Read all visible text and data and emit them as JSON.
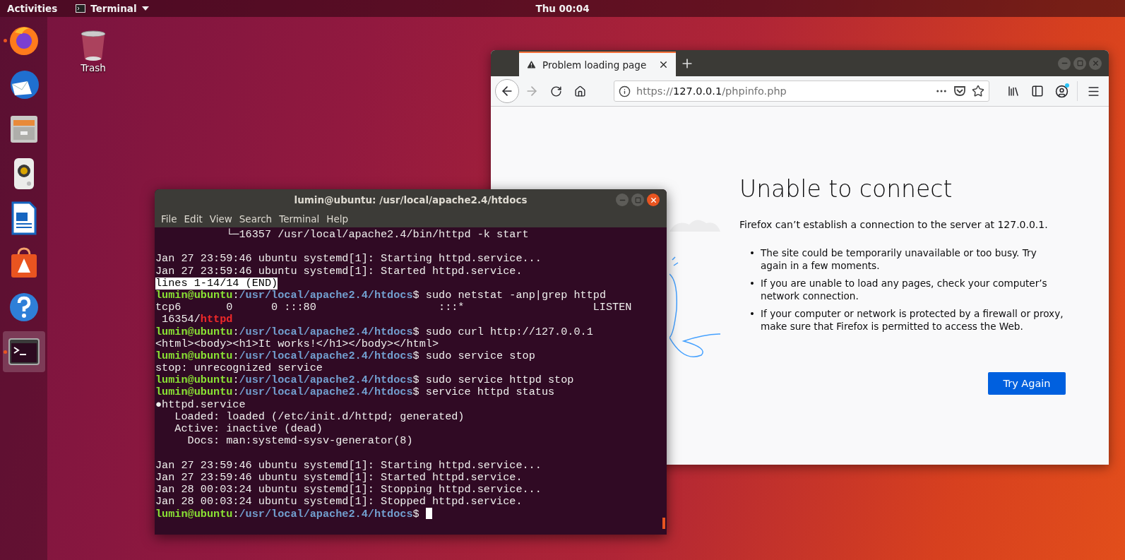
{
  "top_bar": {
    "activities": "Activities",
    "app_menu": "Terminal",
    "clock": "Thu 00:04"
  },
  "dock": {
    "items": [
      {
        "kind": "browser",
        "running": true,
        "selected": false
      },
      {
        "kind": "mail",
        "running": false,
        "selected": false
      },
      {
        "kind": "files",
        "running": false,
        "selected": false
      },
      {
        "kind": "music",
        "running": false,
        "selected": false
      },
      {
        "kind": "writer",
        "running": false,
        "selected": false
      },
      {
        "kind": "store",
        "running": false,
        "selected": false
      },
      {
        "kind": "help",
        "running": false,
        "selected": false
      },
      {
        "kind": "terminal",
        "running": true,
        "selected": true
      }
    ]
  },
  "desktop_icons": [
    {
      "kind": "trash",
      "label": "Trash"
    }
  ],
  "browser": {
    "tabs": [
      {
        "title": "Problem loading page",
        "selected": true
      }
    ],
    "nav_buttons": [
      {
        "kind": "back",
        "disabled": false
      },
      {
        "kind": "forward",
        "disabled": true
      },
      {
        "kind": "reload",
        "disabled": false
      },
      {
        "kind": "home",
        "disabled": false
      }
    ],
    "url": {
      "scheme": "https://",
      "host": "127.0.0.1",
      "path": "/phpinfo.php"
    },
    "account_badge": true,
    "error": {
      "heading": "Unable to connect",
      "message": "Firefox can’t establish a connection to the server at 127.0.0.1.",
      "bullets": [
        {
          "marker": "•",
          "text": "The site could be temporarily unavailable or too busy. Try again in a few moments."
        },
        {
          "marker": "•",
          "text": "If you are unable to load any pages, check your computer’s network connection."
        },
        {
          "marker": "•",
          "text": "If your computer or network is protected by a firewall or proxy, make sure that Firefox is permitted to access the Web."
        }
      ],
      "button": "Try Again"
    }
  },
  "terminal": {
    "title": "lumin@ubuntu: /usr/local/apache2.4/htdocs",
    "menu": [
      "File",
      "Edit",
      "View",
      "Search",
      "Terminal",
      "Help"
    ],
    "lines": [
      {
        "kind": "output",
        "text": "           └─16357 /usr/local/apache2.4/bin/httpd -k start"
      },
      {
        "kind": "blank"
      },
      {
        "kind": "output",
        "text": "Jan 27 23:59:46 ubuntu systemd[1]: Starting httpd.service..."
      },
      {
        "kind": "output",
        "text": "Jan 27 23:59:46 ubuntu systemd[1]: Started httpd.service."
      },
      {
        "kind": "pager",
        "text": "lines 1-14/14 (END)"
      },
      {
        "kind": "prompt",
        "user": "lumin@ubuntu",
        "sep": ":",
        "path": "/usr/local/apache2.4/htdocs",
        "symbol": "$",
        "command": "sudo netstat -anp|grep httpd"
      },
      {
        "kind": "output",
        "text": "tcp6       0      0 :::80                   :::*                    LISTEN"
      },
      {
        "kind": "match",
        "text": " 16354/",
        "match": "httpd"
      },
      {
        "kind": "prompt",
        "user": "lumin@ubuntu",
        "sep": ":",
        "path": "/usr/local/apache2.4/htdocs",
        "symbol": "$",
        "command": "sudo curl http://127.0.0.1"
      },
      {
        "kind": "output",
        "text": "<html><body><h1>It works!</h1></body></html>"
      },
      {
        "kind": "prompt",
        "user": "lumin@ubuntu",
        "sep": ":",
        "path": "/usr/local/apache2.4/htdocs",
        "symbol": "$",
        "command": "sudo service stop"
      },
      {
        "kind": "output",
        "text": "stop: unrecognized service"
      },
      {
        "kind": "prompt",
        "user": "lumin@ubuntu",
        "sep": ":",
        "path": "/usr/local/apache2.4/htdocs",
        "symbol": "$",
        "command": "sudo service httpd stop"
      },
      {
        "kind": "prompt",
        "user": "lumin@ubuntu",
        "sep": ":",
        "path": "/usr/local/apache2.4/htdocs",
        "symbol": "$",
        "command": "service httpd status"
      },
      {
        "kind": "output",
        "text": "●httpd.service"
      },
      {
        "kind": "output",
        "text": "   Loaded: loaded (/etc/init.d/httpd; generated)"
      },
      {
        "kind": "output",
        "text": "   Active: inactive (dead)"
      },
      {
        "kind": "output",
        "text": "     Docs: man:systemd-sysv-generator(8)"
      },
      {
        "kind": "blank"
      },
      {
        "kind": "output",
        "text": "Jan 27 23:59:46 ubuntu systemd[1]: Starting httpd.service..."
      },
      {
        "kind": "output",
        "text": "Jan 27 23:59:46 ubuntu systemd[1]: Started httpd.service."
      },
      {
        "kind": "output",
        "text": "Jan 28 00:03:24 ubuntu systemd[1]: Stopping httpd.service..."
      },
      {
        "kind": "output",
        "text": "Jan 28 00:03:24 ubuntu systemd[1]: Stopped httpd.service."
      },
      {
        "kind": "prompt",
        "user": "lumin@ubuntu",
        "sep": ":",
        "path": "/usr/local/apache2.4/htdocs",
        "symbol": "$",
        "cursor": true
      }
    ]
  }
}
